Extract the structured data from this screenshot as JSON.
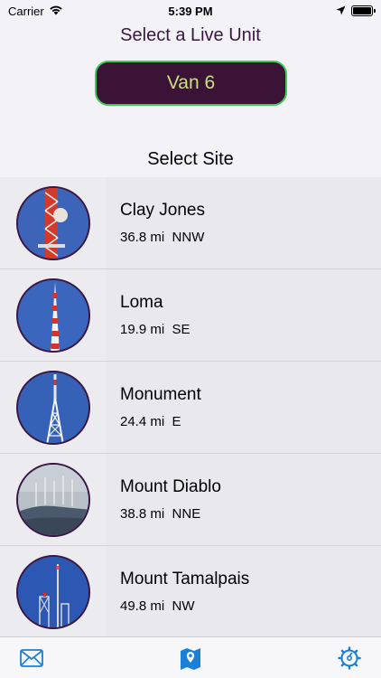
{
  "status_bar": {
    "carrier": "Carrier",
    "time": "5:39 PM"
  },
  "header": {
    "title": "Select a Live Unit",
    "unit_button_label": "Van 6"
  },
  "section_title": "Select Site",
  "sites": [
    {
      "name": "Clay Jones",
      "distance": "36.8 mi",
      "direction": "NNW",
      "thumb": "red-tower-icon"
    },
    {
      "name": "Loma",
      "distance": "19.9 mi",
      "direction": "SE",
      "thumb": "red-white-tower-icon"
    },
    {
      "name": "Monument",
      "distance": "24.4 mi",
      "direction": "E",
      "thumb": "white-tower-icon"
    },
    {
      "name": "Mount Diablo",
      "distance": "38.8 mi",
      "direction": "NNE",
      "thumb": "mountain-towers-icon"
    },
    {
      "name": "Mount Tamalpais",
      "distance": "49.8 mi",
      "direction": "NW",
      "thumb": "lattice-tower-icon"
    }
  ],
  "tab_bar": {
    "items": [
      "envelope-icon",
      "map-pin-icon",
      "gear-icon"
    ]
  },
  "colors": {
    "accent_purple": "#3a1743",
    "button_bg": "#3a1336",
    "button_border": "#3ecb55",
    "button_text": "#c7e47a",
    "tab_blue": "#1a7fd6"
  }
}
